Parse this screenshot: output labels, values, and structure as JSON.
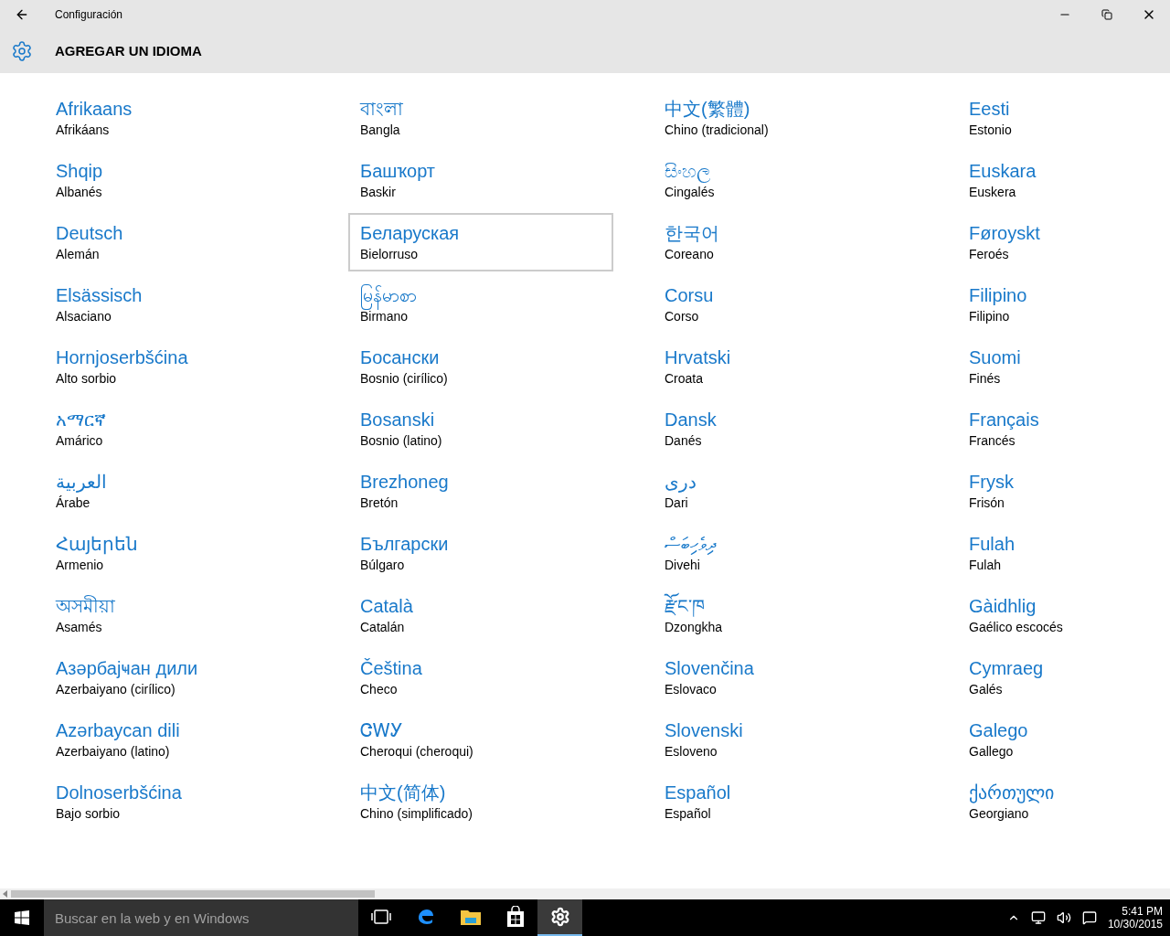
{
  "window": {
    "title": "Configuración"
  },
  "header": {
    "title": "AGREGAR UN IDIOMA"
  },
  "languages": [
    {
      "native": "Afrikaans",
      "name": "Afrikáans",
      "selected": false
    },
    {
      "native": "Shqip",
      "name": "Albanés",
      "selected": false
    },
    {
      "native": "Deutsch",
      "name": "Alemán",
      "selected": false
    },
    {
      "native": "Elsässisch",
      "name": "Alsaciano",
      "selected": false
    },
    {
      "native": "Hornjoserbšćina",
      "name": "Alto sorbio",
      "selected": false
    },
    {
      "native": "አማርኛ",
      "name": "Amárico",
      "selected": false
    },
    {
      "native": "العربية",
      "name": "Árabe",
      "selected": false
    },
    {
      "native": "Հայերեն",
      "name": "Armenio",
      "selected": false
    },
    {
      "native": "অসমীয়া",
      "name": "Asamés",
      "selected": false
    },
    {
      "native": "Азәрбајҹан дили",
      "name": "Azerbaiyano (cirílico)",
      "selected": false
    },
    {
      "native": "Azərbaycan dili",
      "name": "Azerbaiyano (latino)",
      "selected": false
    },
    {
      "native": "Dolnoserbšćina",
      "name": "Bajo sorbio",
      "selected": false
    },
    {
      "native": "বাংলা",
      "name": "Bangla",
      "selected": false
    },
    {
      "native": "Башҡорт",
      "name": "Baskir",
      "selected": false
    },
    {
      "native": "Беларуская",
      "name": "Bielorruso",
      "selected": true
    },
    {
      "native": "မြန်မာစာ",
      "name": "Birmano",
      "selected": false
    },
    {
      "native": "Босански",
      "name": "Bosnio (cirílico)",
      "selected": false
    },
    {
      "native": "Bosanski",
      "name": "Bosnio (latino)",
      "selected": false
    },
    {
      "native": "Brezhoneg",
      "name": "Bretón",
      "selected": false
    },
    {
      "native": "Български",
      "name": "Búlgaro",
      "selected": false
    },
    {
      "native": "Català",
      "name": "Catalán",
      "selected": false
    },
    {
      "native": "Čeština",
      "name": "Checo",
      "selected": false
    },
    {
      "native": "ᏣᎳᎩ",
      "name": "Cheroqui (cheroqui)",
      "selected": false
    },
    {
      "native": "中文(简体)",
      "name": "Chino (simplificado)",
      "selected": false
    },
    {
      "native": "中文(繁體)",
      "name": "Chino (tradicional)",
      "selected": false
    },
    {
      "native": "සිංහල",
      "name": "Cingalés",
      "selected": false
    },
    {
      "native": "한국어",
      "name": "Coreano",
      "selected": false
    },
    {
      "native": "Corsu",
      "name": "Corso",
      "selected": false
    },
    {
      "native": "Hrvatski",
      "name": "Croata",
      "selected": false
    },
    {
      "native": "Dansk",
      "name": "Danés",
      "selected": false
    },
    {
      "native": "درى",
      "name": "Dari",
      "selected": false
    },
    {
      "native": "ދިވެހިބަސް",
      "name": "Divehi",
      "selected": false
    },
    {
      "native": "རྫོང་ཁ",
      "name": "Dzongkha",
      "selected": false
    },
    {
      "native": "Slovenčina",
      "name": "Eslovaco",
      "selected": false
    },
    {
      "native": "Slovenski",
      "name": "Esloveno",
      "selected": false
    },
    {
      "native": "Español",
      "name": "Español",
      "selected": false
    },
    {
      "native": "Eesti",
      "name": "Estonio",
      "selected": false
    },
    {
      "native": "Euskara",
      "name": "Euskera",
      "selected": false
    },
    {
      "native": "Føroyskt",
      "name": "Feroés",
      "selected": false
    },
    {
      "native": "Filipino",
      "name": "Filipino",
      "selected": false
    },
    {
      "native": "Suomi",
      "name": "Finés",
      "selected": false
    },
    {
      "native": "Français",
      "name": "Francés",
      "selected": false
    },
    {
      "native": "Frysk",
      "name": "Frisón",
      "selected": false
    },
    {
      "native": "Fulah",
      "name": "Fulah",
      "selected": false
    },
    {
      "native": "Gàidhlig",
      "name": "Gaélico escocés",
      "selected": false
    },
    {
      "native": "Cymraeg",
      "name": "Galés",
      "selected": false
    },
    {
      "native": "Galego",
      "name": "Gallego",
      "selected": false
    },
    {
      "native": "ქართული",
      "name": "Georgiano",
      "selected": false
    }
  ],
  "taskbar": {
    "search": {
      "placeholder": "Buscar en la web y en Windows"
    },
    "apps": [
      {
        "kind": "taskview",
        "selected": false
      },
      {
        "kind": "edge",
        "selected": false
      },
      {
        "kind": "explorer",
        "selected": false
      },
      {
        "kind": "store",
        "selected": false
      },
      {
        "kind": "settings",
        "selected": true
      }
    ],
    "time": "5:41 PM",
    "date": "10/30/2015"
  }
}
